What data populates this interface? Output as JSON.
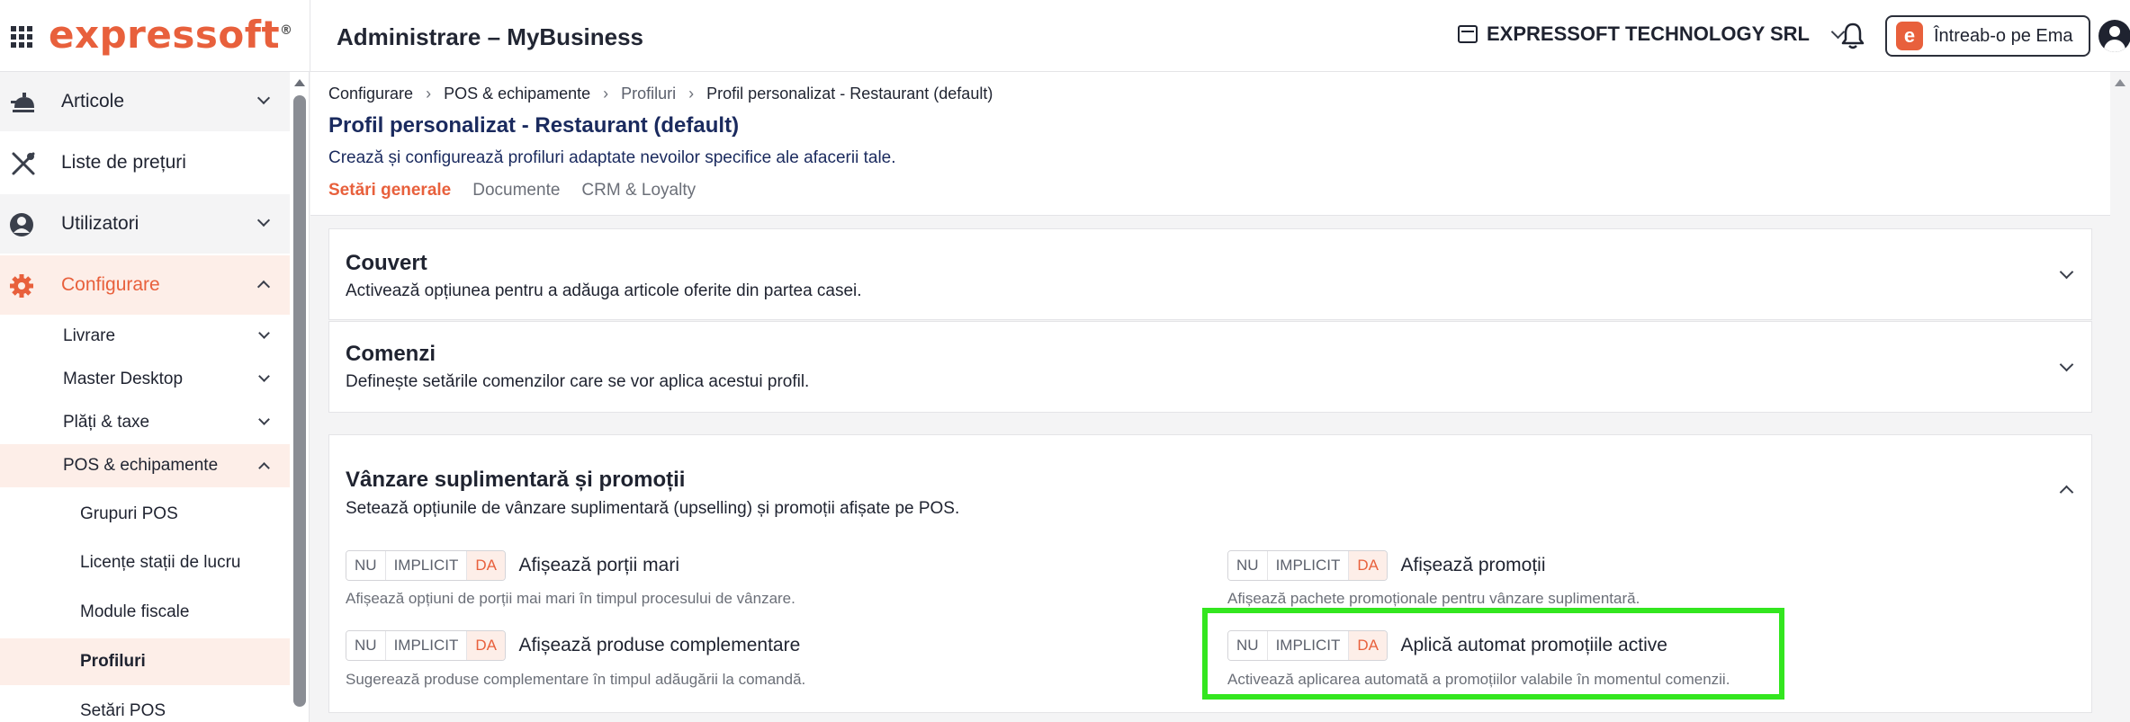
{
  "topbar": {
    "logo_text": "expressoft",
    "logo_mark": "®",
    "app_title": "Administrare – MyBusiness",
    "company": "EXPRESSOFT TECHNOLOGY SRL",
    "ask_label": "Întreab-o pe Ema",
    "ask_badge": "e"
  },
  "sidebar": {
    "items": [
      {
        "label": "Articole",
        "icon": "food-icon"
      },
      {
        "label": "Liste de prețuri",
        "icon": "utensils-icon"
      },
      {
        "label": "Utilizatori",
        "icon": "user-icon"
      },
      {
        "label": "Configurare",
        "icon": "gear-icon"
      }
    ],
    "sub_items": [
      {
        "label": "Livrare"
      },
      {
        "label": "Master Desktop"
      },
      {
        "label": "Plăți & taxe"
      },
      {
        "label": "POS & echipamente"
      }
    ],
    "leaf_items": [
      {
        "label": "Grupuri POS"
      },
      {
        "label": "Licențe stații de lucru"
      },
      {
        "label": "Module fiscale"
      },
      {
        "label": "Profiluri"
      },
      {
        "label": "Setări POS"
      }
    ]
  },
  "breadcrumb": [
    "Configurare",
    "POS & echipamente",
    "Profiluri",
    "Profil personalizat - Restaurant (default)"
  ],
  "breadcrumb_sep": "›",
  "page": {
    "title": "Profil personalizat - Restaurant (default)",
    "subtitle": "Crează și configurează profiluri adaptate nevoilor specifice ale afacerii tale.",
    "tabs": [
      "Setări generale",
      "Documente",
      "CRM & Loyalty"
    ]
  },
  "cards": {
    "couvert": {
      "title": "Couvert",
      "desc": "Activează opțiunea pentru a adăuga articole oferite din partea casei."
    },
    "comenzi": {
      "title": "Comenzi",
      "desc": "Definește setările comenzilor care se vor aplica acestui profil."
    },
    "upsell": {
      "title": "Vânzare suplimentară și promoții",
      "desc": "Setează opțiunile de vânzare suplimentară (upselling) și promoții afișate pe POS."
    }
  },
  "toggle": {
    "no": "NU",
    "default": "IMPLICIT",
    "yes": "DA"
  },
  "options": [
    {
      "label": "Afișează porții mari",
      "desc": "Afișează opțiuni de porții mai mari în timpul procesului de vânzare.",
      "value": "DA"
    },
    {
      "label": "Afișează promoții",
      "desc": "Afișează pachete promoționale pentru vânzare suplimentară.",
      "value": "DA"
    },
    {
      "label": "Afișează produse complementare",
      "desc": "Sugerează produse complementare în timpul adăugării la comandă.",
      "value": "DA"
    },
    {
      "label": "Aplică automat promoțiile active",
      "desc": "Activează aplicarea automată a promoțiilor valabile în momentul comenzii.",
      "value": "DA"
    }
  ],
  "colors": {
    "accent": "#e8603c",
    "accent_bg": "#fdeee8",
    "title_navy": "#1a2a5e",
    "highlight": "#33e61f"
  }
}
